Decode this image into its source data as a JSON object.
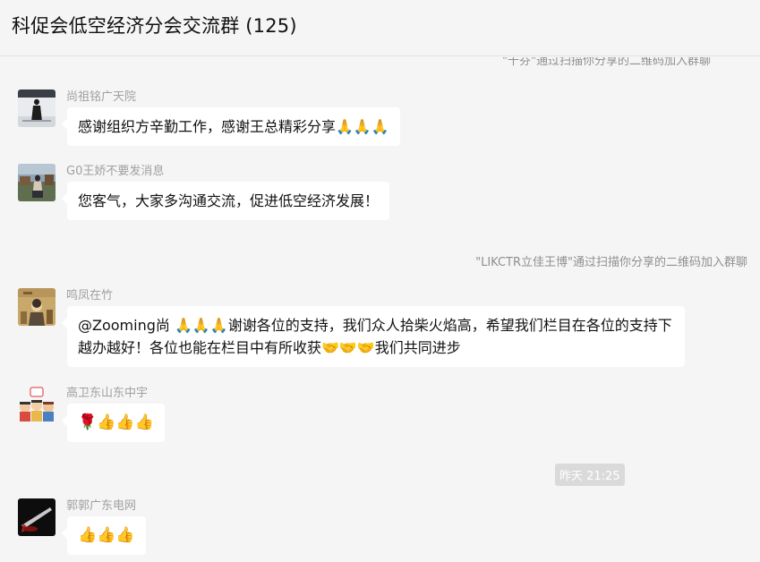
{
  "header": {
    "title": "科促会低空经济分会交流群 (125)"
  },
  "system_notices": {
    "cut_off": "\"千芬\"通过扫描你分享的二维码加入群聊",
    "join": "\"LIKCTR立佳王博\"通过扫描你分享的二维码加入群聊",
    "timestamp": "昨天 21:25"
  },
  "messages": [
    {
      "sender": "尚祖铭广天院",
      "text": "感谢组织方辛勤工作，感谢王总精彩分享🙏🙏🙏"
    },
    {
      "sender": "G0王娇不要发消息",
      "text": "您客气，大家多沟通交流，促进低空经济发展！"
    },
    {
      "sender": "鸣凤在竹",
      "text": "@Zooming尚 🙏🙏🙏谢谢各位的支持，我们众人拾柴火焰高，希望我们栏目在各位的支持下越办越好！各位也能在栏目中有所收获🤝🤝🤝我们共同进步"
    },
    {
      "sender": "高卫东山东中宇",
      "text": "🌹👍👍👍"
    },
    {
      "sender": "郭郭广东电网",
      "text": "👍👍👍"
    }
  ],
  "colors": {
    "background": "#f5f5f5",
    "bubble": "#ffffff",
    "sender_name": "#a0a0a0",
    "system_text": "#8f8f8f",
    "timestamp_bg": "#dadada"
  },
  "icons": [
    "avatar-photo-snow",
    "avatar-photo-person",
    "avatar-illustration",
    "avatar-cartoon-group",
    "avatar-photo-dark"
  ]
}
